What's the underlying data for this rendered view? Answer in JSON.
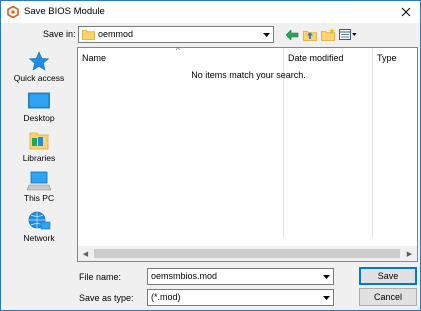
{
  "window": {
    "title": "Save BIOS Module"
  },
  "toolbar": {
    "save_in_label": "Save in:",
    "save_in_value": "oemmod"
  },
  "places": [
    {
      "label": "Quick access",
      "icon": "star-icon"
    },
    {
      "label": "Desktop",
      "icon": "desktop-icon"
    },
    {
      "label": "Libraries",
      "icon": "libraries-icon"
    },
    {
      "label": "This PC",
      "icon": "computer-icon"
    },
    {
      "label": "Network",
      "icon": "network-icon"
    }
  ],
  "filelist": {
    "columns": [
      "Name",
      "Date modified",
      "Type"
    ],
    "empty_message": "No items match your search."
  },
  "form": {
    "file_name_label": "File name:",
    "file_name_value": "oemsmbios.mod",
    "save_as_type_label": "Save as type:",
    "save_as_type_value": "(*.mod)"
  },
  "buttons": {
    "save": "Save",
    "cancel": "Cancel"
  },
  "colors": {
    "accent": "#0078d7",
    "title_border": "#2b79c4"
  }
}
